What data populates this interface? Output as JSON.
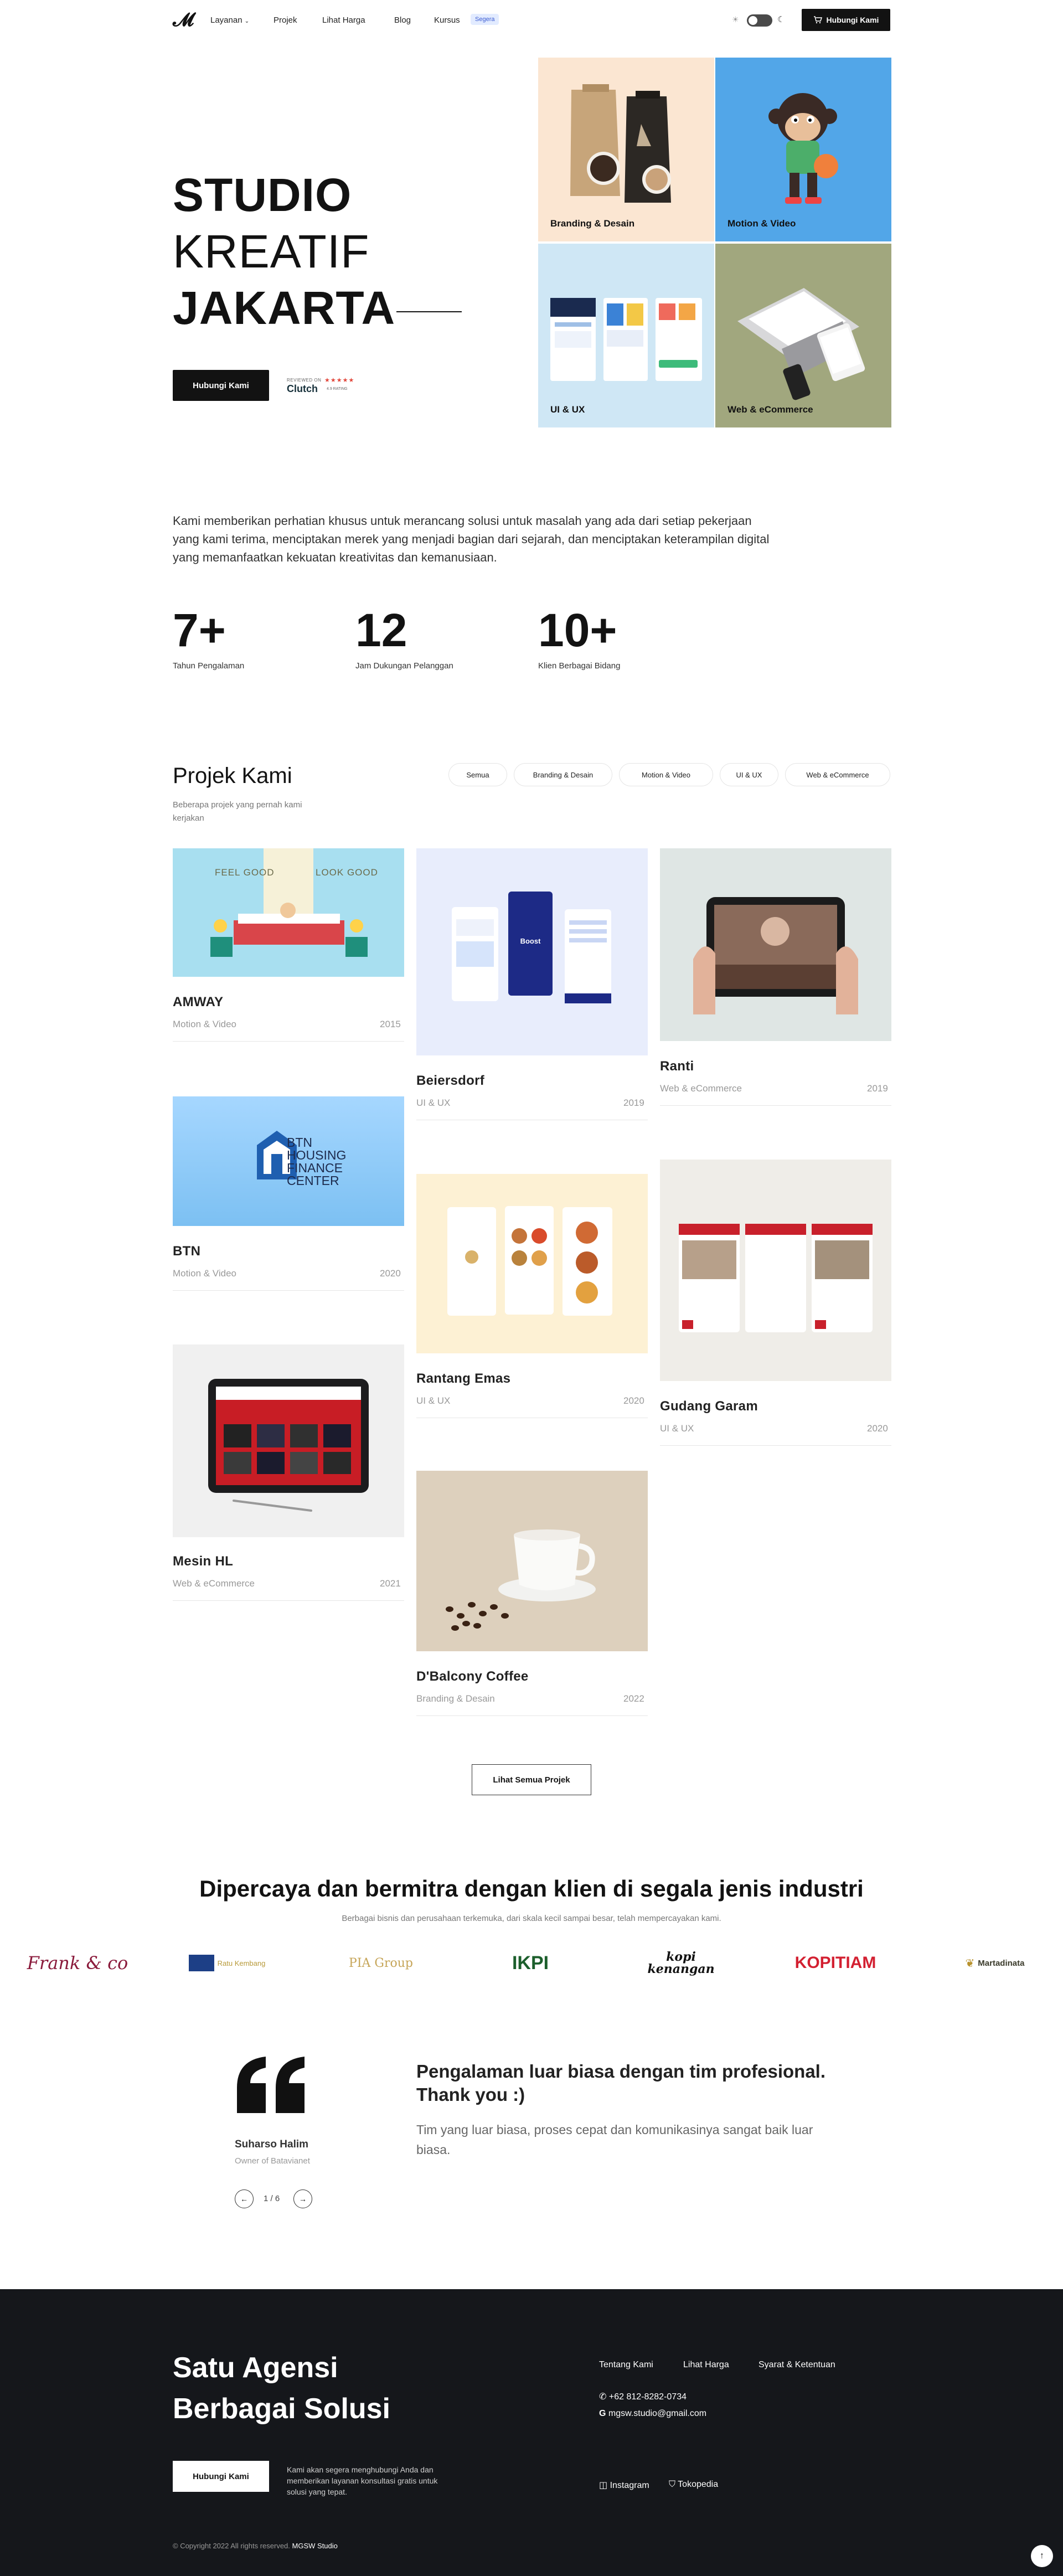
{
  "nav": {
    "logo": "𝓜",
    "links": [
      "Layanan",
      "Projek",
      "Lihat Harga",
      "Blog",
      "Kursus"
    ],
    "badge": "Segera",
    "cta": "Hubungi Kami"
  },
  "hero": {
    "line1": "STUDIO",
    "line2": "KREATIF",
    "line3": "JAKARTA",
    "cta": "Hubungi Kami",
    "clutch_top": "REVIEWED ON",
    "clutch_name": "Clutch",
    "clutch_stars": "★★★★★",
    "clutch_rating": "4.9 RATING",
    "tiles": [
      "Branding & Desain",
      "Motion & Video",
      "UI & UX",
      "Web & eCommerce"
    ]
  },
  "intro": "Kami memberikan perhatian khusus untuk merancang solusi untuk masalah yang ada dari setiap pekerjaan yang kami terima, menciptakan merek yang menjadi bagian dari sejarah, dan menciptakan keterampilan digital yang memanfaatkan kekuatan kreativitas dan kemanusiaan.",
  "stats": [
    {
      "value": "7+",
      "label": "Tahun Pengalaman"
    },
    {
      "value": "12",
      "label": "Jam Dukungan Pelanggan"
    },
    {
      "value": "10+",
      "label": "Klien Berbagai Bidang"
    }
  ],
  "projects": {
    "title": "Projek Kami",
    "subtitle": "Beberapa projek yang pernah kami kerjakan",
    "filters": [
      "Semua",
      "Branding & Desain",
      "Motion & Video",
      "UI & UX",
      "Web & eCommerce"
    ],
    "items": [
      {
        "title": "AMWAY",
        "category": "Motion & Video",
        "year": "2015"
      },
      {
        "title": "BTN",
        "category": "Motion & Video",
        "year": "2020"
      },
      {
        "title": "Mesin HL",
        "category": "Web & eCommerce",
        "year": "2021"
      },
      {
        "title": "Beiersdorf",
        "category": "UI & UX",
        "year": "2019"
      },
      {
        "title": "Rantang Emas",
        "category": "UI & UX",
        "year": "2020"
      },
      {
        "title": "D'Balcony Coffee",
        "category": "Branding & Desain",
        "year": "2022"
      },
      {
        "title": "Ranti",
        "category": "Web & eCommerce",
        "year": "2019"
      },
      {
        "title": "Gudang Garam",
        "category": "UI & UX",
        "year": "2020"
      }
    ],
    "img_text": {
      "feel_good": "FEEL GOOD",
      "look_good": "LOOK GOOD",
      "btn_logo": "BTN\nHOUSING\nFINANCE\nCENTER",
      "boost": "Boost"
    },
    "see_all": "Lihat Semua Projek"
  },
  "clients": {
    "title": "Dipercaya dan bermitra dengan klien di segala jenis industri",
    "subtitle": "Berbagai bisnis dan perusahaan terkemuka, dari skala kecil sampai besar, telah mempercayakan kami.",
    "logos": [
      "Frank & co",
      "Ratu Kembang",
      "PIA Group",
      "IKPI",
      "kopi kenangan",
      "KOPITIAM",
      "Martadinata"
    ]
  },
  "testimonial": {
    "quote_mark": "❝",
    "author": "Suharso Halim",
    "role": "Owner of Batavianet",
    "pager": "1 / 6",
    "headline": "Pengalaman luar biasa dengan tim profesional. Thank you :)",
    "body": "Tim yang luar biasa, proses cepat dan komunikasinya sangat baik luar biasa."
  },
  "footer": {
    "title_1": "Satu Agensi",
    "title_2": "Berbagai Solusi",
    "cta": "Hubungi Kami",
    "cta_desc": "Kami akan segera menghubungi Anda dan memberikan layanan konsultasi gratis untuk solusi yang tepat.",
    "links": [
      "Tentang Kami",
      "Lihat Harga",
      "Syarat & Ketentuan"
    ],
    "phone": "+62 812-8282-0734",
    "email": "mgsw.studio@gmail.com",
    "social": [
      "Instagram",
      "Tokopedia"
    ],
    "copyright": "© Copyright 2022 All rights reserved.",
    "brand": "MGSW Studio"
  },
  "colors": {
    "dark": "#121212",
    "footer_bg": "#15171b",
    "tile_branding": "#fbe6d2",
    "tile_motion": "#52a6e8",
    "tile_uiux": "#cfe7f5",
    "tile_web": "#a1a77e"
  }
}
